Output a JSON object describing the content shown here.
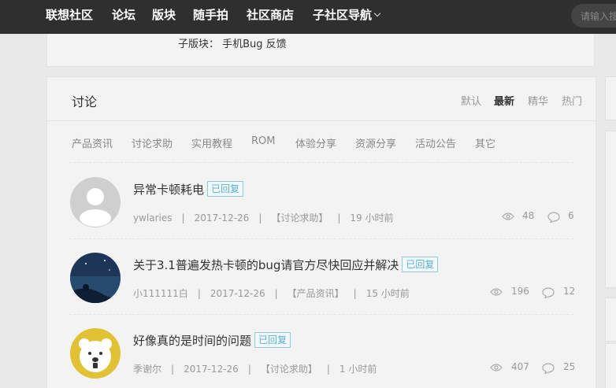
{
  "nav": {
    "items": [
      "联想社区",
      "论坛",
      "版块",
      "随手拍",
      "社区商店",
      "子社区导航"
    ],
    "search_placeholder": "请输入搜"
  },
  "subboard": {
    "label": "子版块：  手机Bug 反馈"
  },
  "panel": {
    "title": "讨论",
    "sort_options": [
      "默认",
      "最新",
      "精华",
      "热门"
    ],
    "active_sort": "最新",
    "categories": [
      "产品资讯",
      "讨论求助",
      "实用教程",
      "ROM",
      "体验分享",
      "资源分享",
      "活动公告",
      "其它"
    ]
  },
  "threads": [
    {
      "title": "异常卡顿耗电",
      "badge": "已回复",
      "author": "ywlaries",
      "date": "2017-12-26",
      "category": "【讨论求助】",
      "time": "19 小时前",
      "views": "48",
      "replies": "6",
      "avatar": "default-avatar"
    },
    {
      "title": "关于3.1普遍发热卡顿的bug请官方尽快回应并解决",
      "badge": "已回复",
      "author": "小111111白",
      "date": "2017-12-26",
      "category": "【产品资讯】",
      "time": "15 小时前",
      "views": "196",
      "replies": "12",
      "avatar": "night-sky-avatar"
    },
    {
      "title": "好像真的是时间的问题",
      "badge": "已回复",
      "author": "季谢尔",
      "date": "2017-12-26",
      "category": "【讨论求助】",
      "time": "1 小时前",
      "views": "407",
      "replies": "25",
      "avatar": "polar-bear-avatar"
    }
  ],
  "colors": {
    "nav_bg": "#2f2f2f",
    "badge": "#5ab0d0",
    "page_bg": "#e9e9e9"
  },
  "icons": {
    "views": "eye-icon",
    "replies": "comment-icon"
  }
}
